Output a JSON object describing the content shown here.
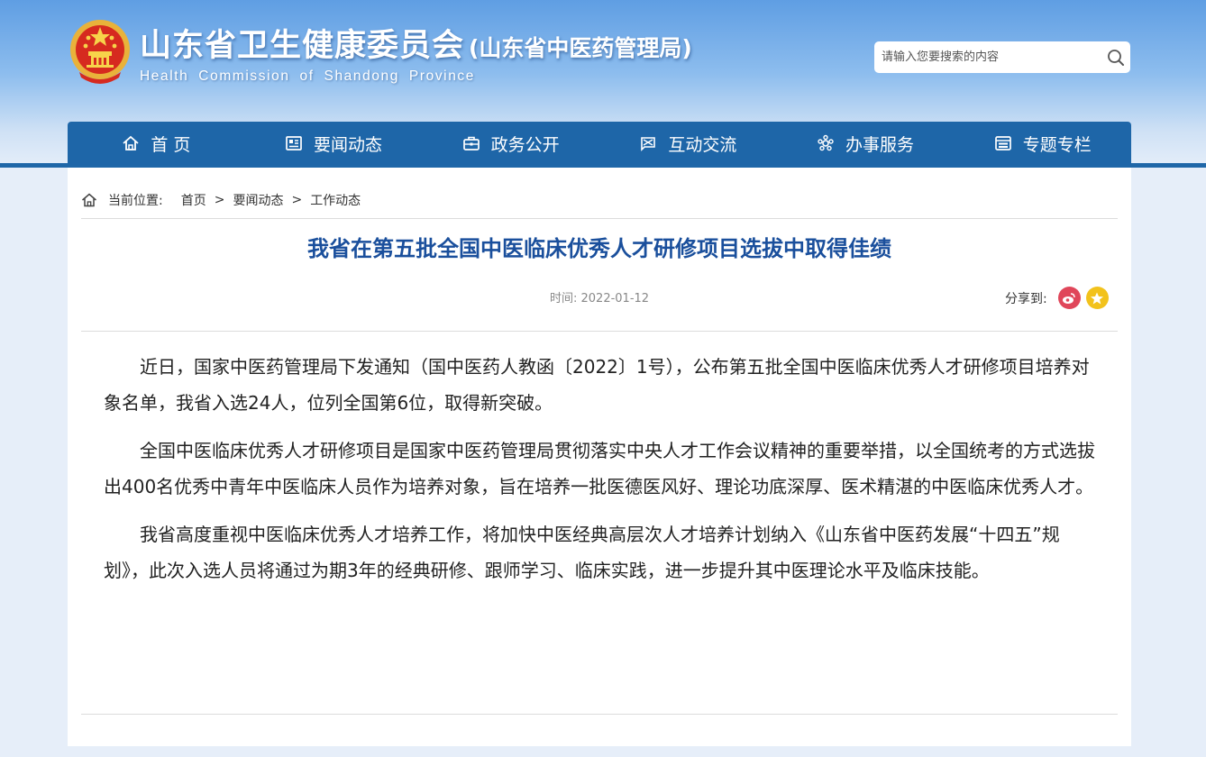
{
  "header": {
    "title": "山东省卫生健康委员会",
    "subtitle": "(山东省中医药管理局)",
    "english": "Health Commission of Shandong Province",
    "logo_icon": "national-emblem-icon"
  },
  "search": {
    "placeholder": "请输入您要搜索的内容",
    "icon": "search-icon"
  },
  "nav": {
    "items": [
      {
        "label": "首 页",
        "icon": "home-icon"
      },
      {
        "label": "要闻动态",
        "icon": "news-icon"
      },
      {
        "label": "政务公开",
        "icon": "briefcase-icon"
      },
      {
        "label": "互动交流",
        "icon": "interaction-icon"
      },
      {
        "label": "办事服务",
        "icon": "service-icon"
      },
      {
        "label": "专题专栏",
        "icon": "column-icon"
      }
    ]
  },
  "breadcrumb": {
    "label": "当前位置:",
    "items": [
      "首页",
      "要闻动态",
      "工作动态"
    ],
    "separator": ">"
  },
  "article": {
    "title": "我省在第五批全国中医临床优秀人才研修项目选拔中取得佳绩",
    "time": "时间: 2022-01-12",
    "share_label": "分享到:",
    "paragraphs": [
      "近日，国家中医药管理局下发通知（国中医药人教函〔2022〕1号），公布第五批全国中医临床优秀人才研修项目培养对象名单，我省入选24人，位列全国第6位，取得新突破。",
      "全国中医临床优秀人才研修项目是国家中医药管理局贯彻落实中央人才工作会议精神的重要举措，以全国统考的方式选拔出400名优秀中青年中医临床人员作为培养对象，旨在培养一批医德医风好、理论功底深厚、医术精湛的中医临床优秀人才。",
      "我省高度重视中医临床优秀人才培养工作，将加快中医经典高层次人才培养计划纳入《山东省中医药发展“十四五”规划》，此次入选人员将通过为期3年的经典研修、跟师学习、临床实践，进一步提升其中医理论水平及临床技能。"
    ]
  },
  "colors": {
    "nav_bg": "#1e66a8",
    "title_color": "#1a4f9c",
    "weibo": "#e0465a",
    "qzone": "#f2c21c"
  }
}
